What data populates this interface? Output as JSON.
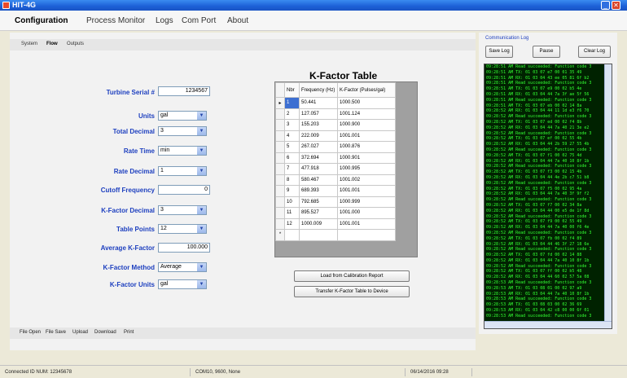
{
  "window": {
    "title": "HIT-4G"
  },
  "menu": [
    "Configuration",
    "Process Monitor",
    "Logs",
    "Com Port",
    "About"
  ],
  "subtabs": [
    "System",
    "Flow",
    "Outputs"
  ],
  "fields": [
    {
      "label": "Turbine Serial #",
      "value": "1234567",
      "type": "text"
    },
    {
      "label": "Units",
      "value": "gal",
      "type": "select"
    },
    {
      "label": "Total Decimal",
      "value": "3",
      "type": "select"
    },
    {
      "label": "Rate Time",
      "value": "min",
      "type": "select"
    },
    {
      "label": "Rate Decimal",
      "value": "1",
      "type": "select"
    },
    {
      "label": "Cutoff Frequency",
      "value": "0",
      "type": "text"
    },
    {
      "label": "K-Factor Decimal",
      "value": "3",
      "type": "select"
    },
    {
      "label": "Table Points",
      "value": "12",
      "type": "select"
    },
    {
      "label": "Average K-Factor",
      "value": "100.000",
      "type": "text"
    },
    {
      "label": "K-Factor Method",
      "value": "Average",
      "type": "select"
    },
    {
      "label": "K-Factor Units",
      "value": "gal",
      "type": "select"
    }
  ],
  "kfactor_table": {
    "title": "K-Factor Table",
    "columns": [
      "Nbr",
      "Frequency (Hz)",
      "K-Factor (Pulses/gal)"
    ],
    "rows": [
      [
        "1",
        "50.441",
        "1000.500"
      ],
      [
        "2",
        "127.057",
        "1001.124"
      ],
      [
        "3",
        "155.203",
        "1000.900"
      ],
      [
        "4",
        "222.009",
        "1001.001"
      ],
      [
        "5",
        "267.027",
        "1000.876"
      ],
      [
        "6",
        "372.694",
        "1000.901"
      ],
      [
        "7",
        "477.918",
        "1000.995"
      ],
      [
        "8",
        "580.467",
        "1001.002"
      ],
      [
        "9",
        "689.393",
        "1001.001"
      ],
      [
        "10",
        "792.685",
        "1000.999"
      ],
      [
        "11",
        "895.527",
        "1001.000"
      ],
      [
        "12",
        "1000.009",
        "1001.001"
      ]
    ],
    "new_row_marker": "*",
    "current_row_marker": "▸"
  },
  "buttons": {
    "load_report": "Load from Calibration Report",
    "transfer": "Transfer K-Factor Table to Device"
  },
  "bottom_actions": [
    "File Open",
    "File Save",
    "Upload",
    "Download",
    "Print"
  ],
  "comm_log": {
    "title": "Communication Log",
    "save": "Save Log",
    "pause": "Pause",
    "clear": "Clear Log",
    "lines": [
      "09:28:51 AM  Read succeeded: Function code 3",
      "09:28:51 AM  TX: 01 03 07 e7 00 01 35 49",
      "09:28:51 AM  RX: 01 03 04 43 ee 05 81 6f b2",
      "09:28:51 AM  Read succeeded: Function code 3",
      "09:28:51 AM  TX: 01 03 07 e9 00 02 b5 4e",
      "09:28:51 AM  RX: 01 03 04 44 7a 3f ae 5f 56",
      "09:28:51 AM  Read succeeded: Function code 3",
      "09:28:51 AM  TX: 01 03 07 eb 00 02 14 8a",
      "09:28:52 AM  RX: 01 03 04 44 11 1d e3 f6 70",
      "09:28:52 AM  Read succeeded: Function code 3",
      "09:28:52 AM  TX: 01 03 07 ed 00 02 f4 8b",
      "09:28:52 AM  RX: 01 03 04 44 7a 40 21 3e e2",
      "09:28:52 AM  Read succeeded: Function code 3",
      "09:28:52 AM  TX: 01 03 07 ef 00 02 55 4b",
      "09:28:52 AM  RX: 01 03 04 44 2b 59 27 55 4b",
      "09:28:52 AM  Read succeeded: Function code 3",
      "09:28:52 AM  TX: 01 03 07 f1 00 02 75 4d",
      "09:28:52 AM  RX: 01 03 04 44 7a 40 10 8f 1b",
      "09:28:52 AM  Read succeeded: Function code 3",
      "09:28:52 AM  TX: 01 03 07 f3 00 02 15 4b",
      "09:28:52 AM  RX: 01 03 04 44 4e 2b c7 51 b8",
      "09:28:52 AM  Read succeeded: Function code 3",
      "09:28:52 AM  TX: 01 03 07 f5 00 02 95 4a",
      "09:28:52 AM  RX: 01 03 04 44 7a 40 3f 9f f2",
      "09:28:52 AM  Read succeeded: Function code 3",
      "09:28:52 AM  TX: 01 03 07 f7 00 02 34 8a",
      "09:28:52 AM  RX: 01 03 04 44 00 e5 de 1f 8d",
      "09:28:52 AM  Read succeeded: Function code 3",
      "09:28:52 AM  TX: 01 03 07 f9 00 02 55 49",
      "09:28:52 AM  RX: 01 03 04 44 7a 40 00 f6 4e",
      "09:28:52 AM  Read succeeded: Function code 3",
      "09:28:52 AM  TX: 01 03 07 fb 00 02 f4 89",
      "09:28:52 AM  RX: 01 03 04 44 46 3f 27 18 6e",
      "09:28:52 AM  Read succeeded: Function code 3",
      "09:28:52 AM  TX: 01 03 07 fd 00 02 14 88",
      "09:28:52 AM  RX: 01 03 04 44 7a 40 10 8f 1b",
      "09:28:52 AM  Read succeeded: Function code 3",
      "09:28:52 AM  TX: 01 03 07 ff 00 02 b5 48",
      "09:28:52 AM  RX: 01 03 04 44 60 02 57 5a 08",
      "09:28:53 AM  Read succeeded: Function code 3",
      "09:28:53 AM  TX: 01 03 08 01 00 02 97 a9",
      "09:28:53 AM  RX: 01 03 04 44 7a 40 10 8f 1b",
      "09:28:53 AM  Read succeeded: Function code 3",
      "09:28:53 AM  TX: 01 03 08 03 00 02 36 69",
      "09:28:53 AM  RX: 01 03 04 42 c8 00 00 6f 01",
      "09:28:53 AM  Read succeeded: Function code 3"
    ]
  },
  "status": {
    "connection": "Connected ID NUM: 12345678",
    "port": "COM10, 9600, None",
    "datetime": "06/14/2016 09:28"
  }
}
